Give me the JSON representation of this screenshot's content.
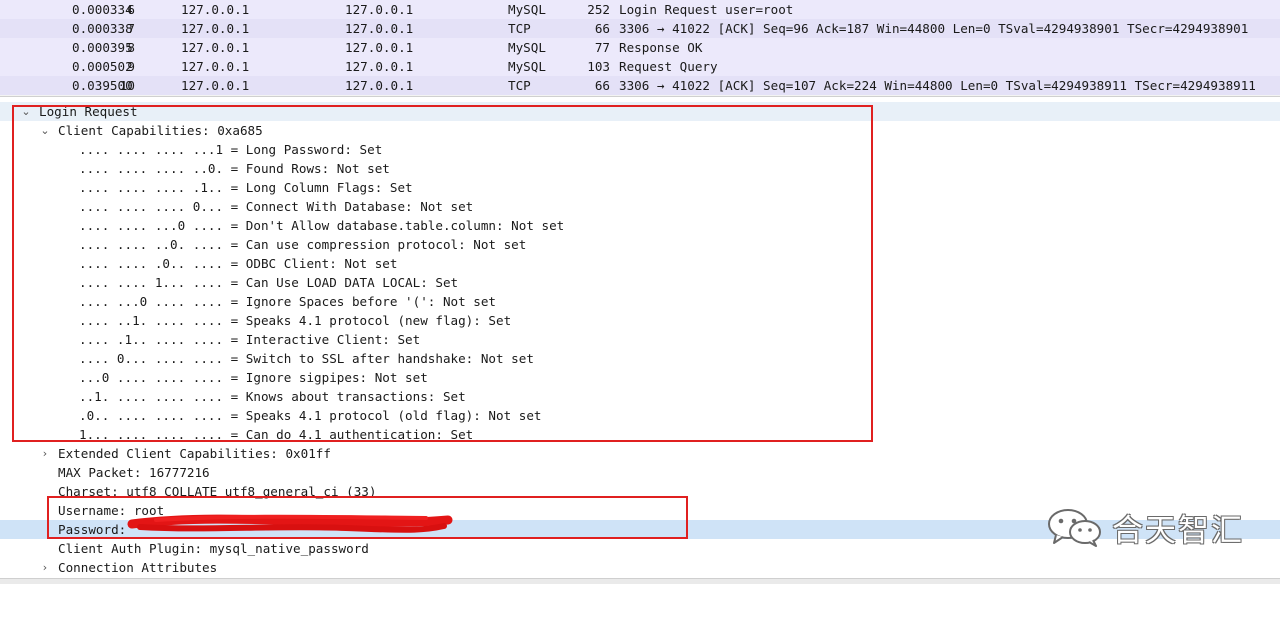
{
  "packets": [
    {
      "no": "6",
      "time": "0.000334",
      "src": "127.0.0.1",
      "dst": "127.0.0.1",
      "proto": "MySQL",
      "len": "252",
      "info": "Login Request user=root"
    },
    {
      "no": "7",
      "time": "0.000338",
      "src": "127.0.0.1",
      "dst": "127.0.0.1",
      "proto": "TCP",
      "len": "66",
      "info": "3306 → 41022 [ACK] Seq=96 Ack=187 Win=44800 Len=0 TSval=4294938901 TSecr=4294938901"
    },
    {
      "no": "8",
      "time": "0.000395",
      "src": "127.0.0.1",
      "dst": "127.0.0.1",
      "proto": "MySQL",
      "len": "77",
      "info": "Response OK"
    },
    {
      "no": "9",
      "time": "0.000502",
      "src": "127.0.0.1",
      "dst": "127.0.0.1",
      "proto": "MySQL",
      "len": "103",
      "info": "Request Query"
    },
    {
      "no": "10",
      "time": "0.039500",
      "src": "127.0.0.1",
      "dst": "127.0.0.1",
      "proto": "TCP",
      "len": "66",
      "info": "3306 → 41022 [ACK] Seq=107 Ack=224 Win=44800 Len=0 TSval=4294938911 TSecr=4294938911"
    }
  ],
  "tree": {
    "login_request": "Login Request",
    "client_capabilities": "Client Capabilities: 0xa685",
    "flags": [
      ".... .... .... ...1 = Long Password: Set",
      ".... .... .... ..0. = Found Rows: Not set",
      ".... .... .... .1.. = Long Column Flags: Set",
      ".... .... .... 0... = Connect With Database: Not set",
      ".... .... ...0 .... = Don't Allow database.table.column: Not set",
      ".... .... ..0. .... = Can use compression protocol: Not set",
      ".... .... .0.. .... = ODBC Client: Not set",
      ".... .... 1... .... = Can Use LOAD DATA LOCAL: Set",
      ".... ...0 .... .... = Ignore Spaces before '(': Not set",
      ".... ..1. .... .... = Speaks 4.1 protocol (new flag): Set",
      ".... .1.. .... .... = Interactive Client: Set",
      ".... 0... .... .... = Switch to SSL after handshake: Not set",
      "...0 .... .... .... = Ignore sigpipes: Not set",
      "..1. .... .... .... = Knows about transactions: Set",
      ".0.. .... .... .... = Speaks 4.1 protocol (old flag): Not set",
      "1... .... .... .... = Can do 4.1 authentication: Set"
    ],
    "extended_caps": "Extended Client Capabilities: 0x01ff",
    "max_packet": "MAX Packet: 16777216",
    "charset": "Charset: utf8 COLLATE utf8_general_ci (33)",
    "username": "Username: root",
    "password": "Password: ",
    "auth_plugin": "Client Auth Plugin: mysql_native_password",
    "connection_attributes": "Connection Attributes"
  },
  "watermark": {
    "text": "合天智汇",
    "icon": "wechat-icon"
  },
  "colors": {
    "highlight_box": "#e02020",
    "mysql_row": "#ece9fb",
    "tcp_row": "#e4e1f7",
    "selected_row": "#cfe3f7"
  }
}
